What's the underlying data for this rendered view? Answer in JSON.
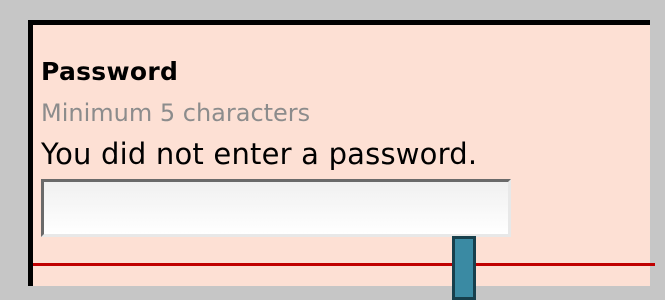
{
  "form": {
    "field_label": "Password",
    "hint": "Minimum 5 characters",
    "error_message": "You did not enter a password.",
    "input_value": ""
  },
  "colors": {
    "panel_background": "#fde0d4",
    "error_rule": "#c00000",
    "handle": "#3a8aa3"
  }
}
